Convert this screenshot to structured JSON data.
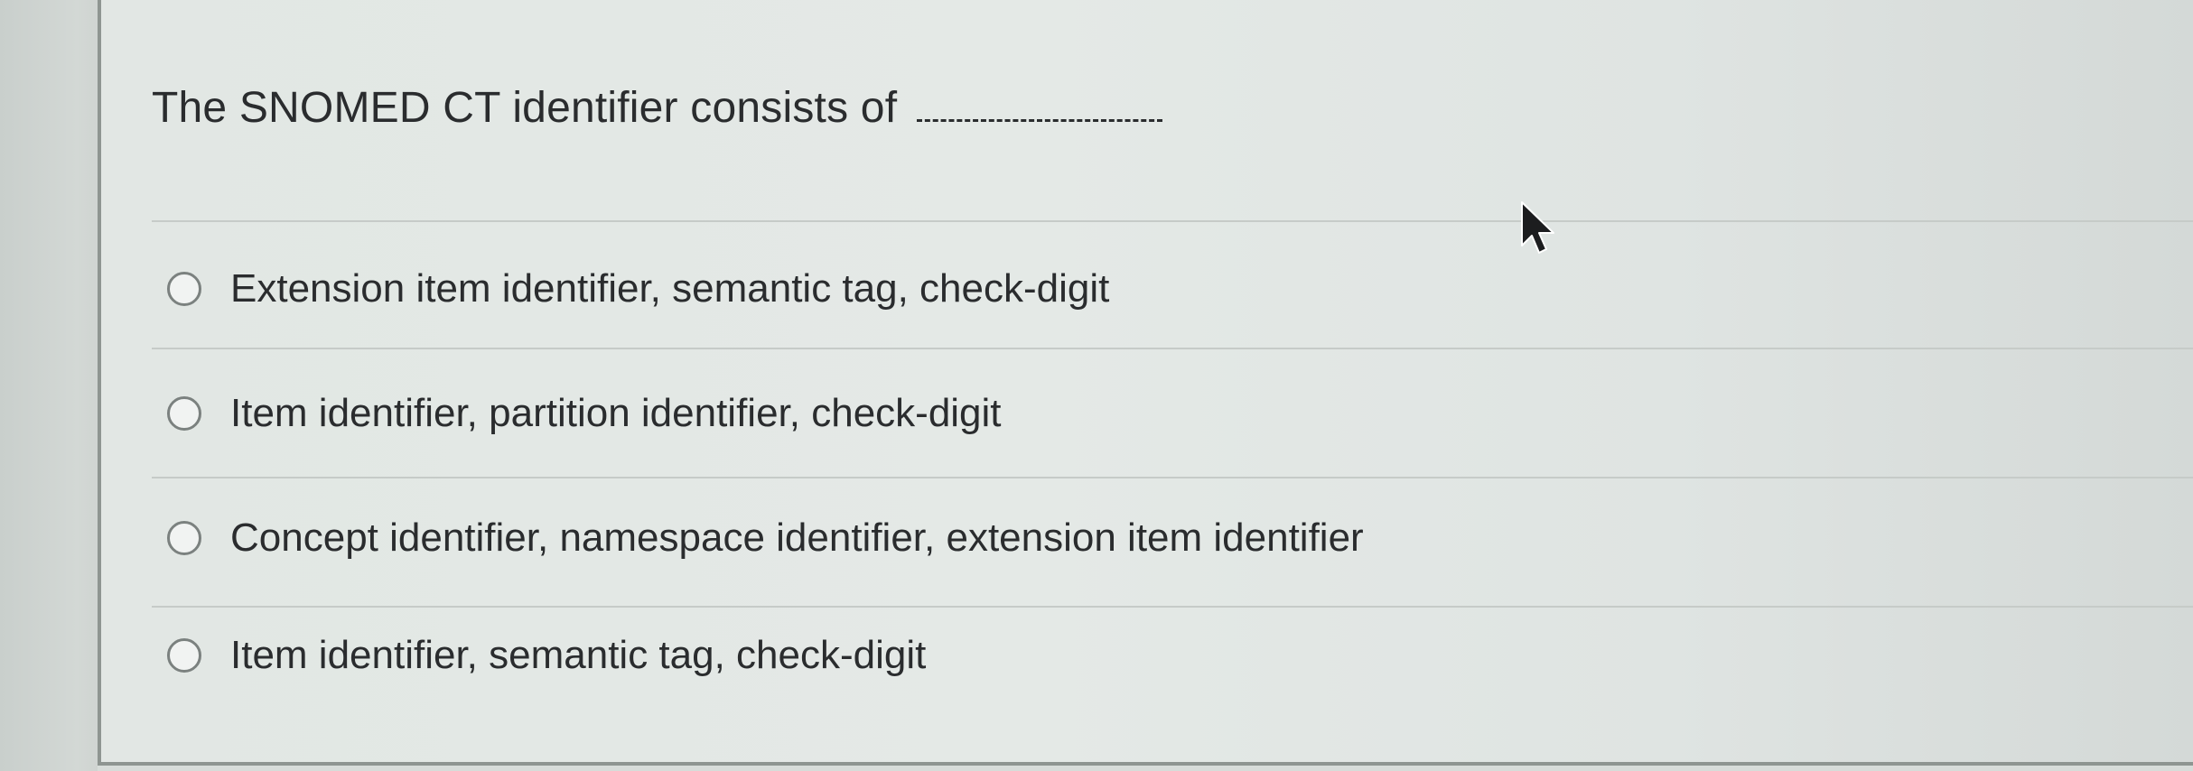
{
  "question": {
    "text": "The SNOMED CT identifier consists of"
  },
  "options": [
    {
      "label": "Extension item identifier, semantic tag, check-digit",
      "selected": false
    },
    {
      "label": "Item identifier, partition identifier, check-digit",
      "selected": false
    },
    {
      "label": "Concept identifier, namespace identifier, extension item identifier",
      "selected": false
    },
    {
      "label": "Item identifier, semantic tag, check-digit",
      "selected": false
    }
  ],
  "cursor": {
    "icon": "mouse-pointer-icon"
  }
}
